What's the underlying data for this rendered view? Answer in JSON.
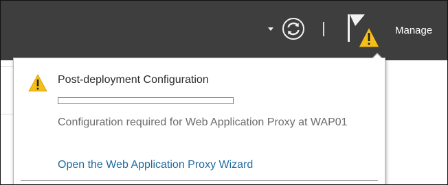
{
  "header": {
    "manage_label": "Manage",
    "refresh_icon": "refresh-icon",
    "flag_icon": "notifications-flag-icon",
    "flag_badge_icon": "warning-icon"
  },
  "notification": {
    "warning_icon": "warning-icon",
    "title": "Post-deployment Configuration",
    "progress": 0,
    "message": "Configuration required for Web Application Proxy at WAP01",
    "link": "Open the Web Application Proxy Wizard"
  },
  "colors": {
    "header_bg": "#3e3e3e",
    "warning": "#f5bf17",
    "link": "#1f6a9e",
    "message": "#6b6b6b"
  }
}
